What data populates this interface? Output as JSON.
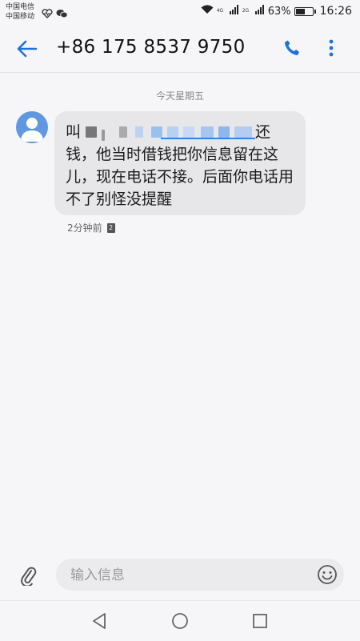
{
  "status_bar": {
    "carrier_1": "中国电信",
    "carrier_2": "中国移动",
    "battery": "63%",
    "battery_level": 0.63,
    "time": "16:26",
    "net_1": "4G",
    "net_2": "2G",
    "icons": [
      "health-heart-icon",
      "wechat-icon",
      "wifi-icon",
      "signal-icon",
      "battery-icon"
    ]
  },
  "header": {
    "title": "+86 175 8537 9750",
    "back_icon": "back-arrow-icon",
    "call_icon": "phone-icon",
    "more_icon": "more-vert-icon",
    "accent_color": "#1e73d8"
  },
  "conversation": {
    "date_label": "今天星期五",
    "message": {
      "text_line1_start": "叫",
      "text_line1_end": "还",
      "text_rest": "钱，他当时借钱把你信息留在这儿，现在电话不接。后面你电话用不了别怪没提醒",
      "time": "2分钟前",
      "sim": "2",
      "bubble_color": "#e7e7ea",
      "avatar_color": "#5f98e0"
    }
  },
  "input_bar": {
    "placeholder": "输入信息",
    "attach_icon": "paperclip-icon",
    "emoji_icon": "emoji-icon"
  },
  "nav_bar": {
    "icons": [
      "nav-back-icon",
      "nav-home-icon",
      "nav-recents-icon"
    ]
  }
}
